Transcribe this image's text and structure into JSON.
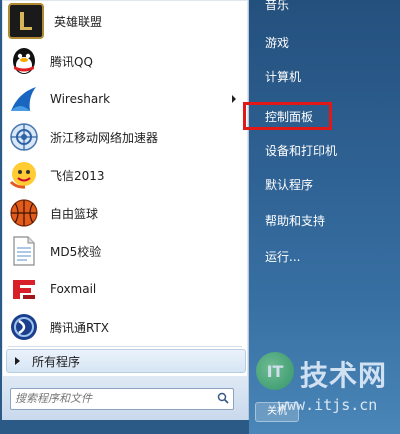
{
  "left_items": [
    {
      "label": "英雄联盟",
      "icon": "league-of-legends-icon"
    },
    {
      "label": "腾讯QQ",
      "icon": "qq-penguin-icon"
    },
    {
      "label": "Wireshark",
      "icon": "wireshark-fin-icon",
      "has_submenu": true
    },
    {
      "label": "浙江移动网络加速器",
      "icon": "network-accelerator-icon"
    },
    {
      "label": "飞信2013",
      "icon": "fetion-icon"
    },
    {
      "label": "自由篮球",
      "icon": "basketball-icon"
    },
    {
      "label": "MD5校验",
      "icon": "document-icon"
    },
    {
      "label": "Foxmail",
      "icon": "foxmail-icon"
    },
    {
      "label": "腾讯通RTX",
      "icon": "rtx-icon"
    }
  ],
  "all_programs": "所有程序",
  "search": {
    "placeholder": "搜索程序和文件"
  },
  "right_items": [
    {
      "label": "音乐"
    },
    {
      "label": "游戏"
    },
    {
      "label": "计算机"
    },
    {
      "label": "控制面板",
      "highlighted": true
    },
    {
      "label": "设备和打印机"
    },
    {
      "label": "默认程序"
    },
    {
      "label": "帮助和支持"
    },
    {
      "label": "运行..."
    }
  ],
  "watermark": {
    "text": "技术网",
    "url": "www.itjs.cn",
    "logo_text": "IT"
  },
  "partial_button": "关机",
  "colors": {
    "highlight": "#e01818",
    "right_panel": "#2f6294"
  }
}
